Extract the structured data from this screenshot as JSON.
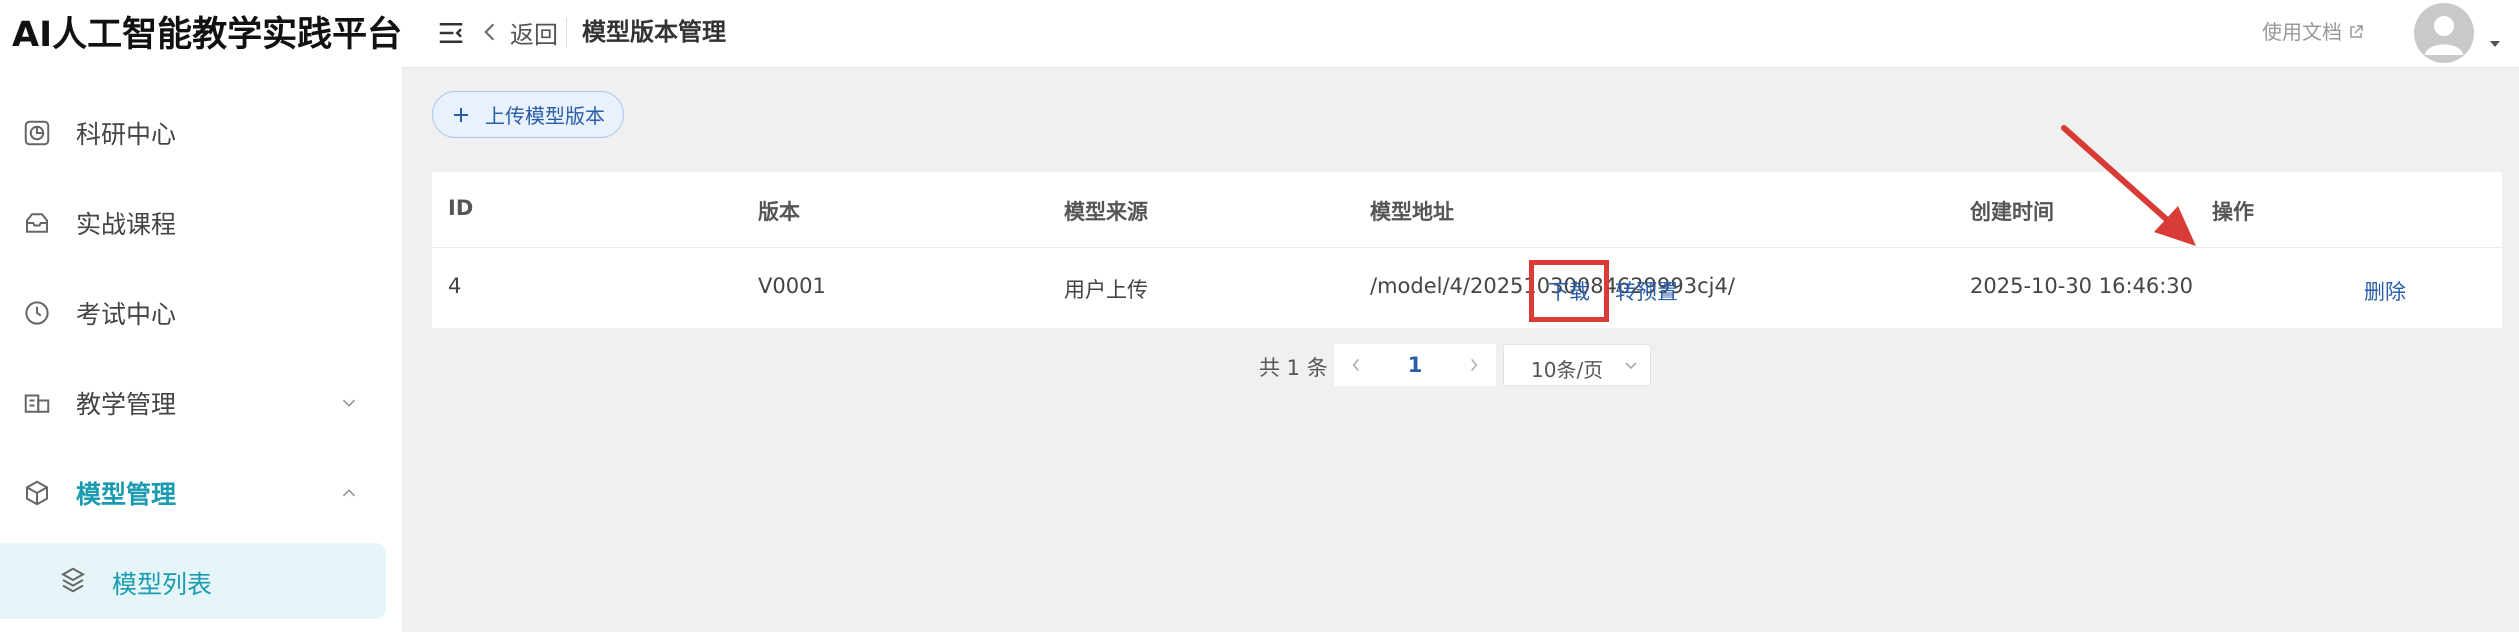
{
  "app": {
    "brand": "AI人工智能教学实践平台"
  },
  "sidebar": {
    "items": [
      {
        "label": "科研中心",
        "icon": "pie-chart-icon"
      },
      {
        "label": "实战课程",
        "icon": "inbox-icon"
      },
      {
        "label": "考试中心",
        "icon": "clock-icon"
      },
      {
        "label": "教学管理",
        "icon": "teaching-icon",
        "expanded": false
      },
      {
        "label": "模型管理",
        "icon": "cube-icon",
        "expanded": true,
        "active": true
      }
    ],
    "sub_items": [
      {
        "label": "模型列表",
        "icon": "layers-icon",
        "active": true
      }
    ],
    "accent_color": "#1a9bb0"
  },
  "header": {
    "back_label": "返回",
    "page_title": "模型版本管理",
    "docs_label": "使用文档"
  },
  "toolbar": {
    "upload_label": "上传模型版本"
  },
  "table": {
    "columns": [
      "ID",
      "版本",
      "模型来源",
      "模型地址",
      "创建时间",
      "操作"
    ],
    "rows": [
      {
        "id": "4",
        "version": "V0001",
        "source": "用户上传",
        "path": "/model/4/20251030084629993cj4/",
        "created": "2025-10-30 16:46:30",
        "actions": [
          "下载",
          "转预置",
          "删除"
        ]
      }
    ]
  },
  "pagination": {
    "total_text": "共 1 条",
    "current_page": "1",
    "page_size": "10条/页"
  },
  "colors": {
    "link": "#2a5ea8",
    "highlight": "#d93b36"
  }
}
